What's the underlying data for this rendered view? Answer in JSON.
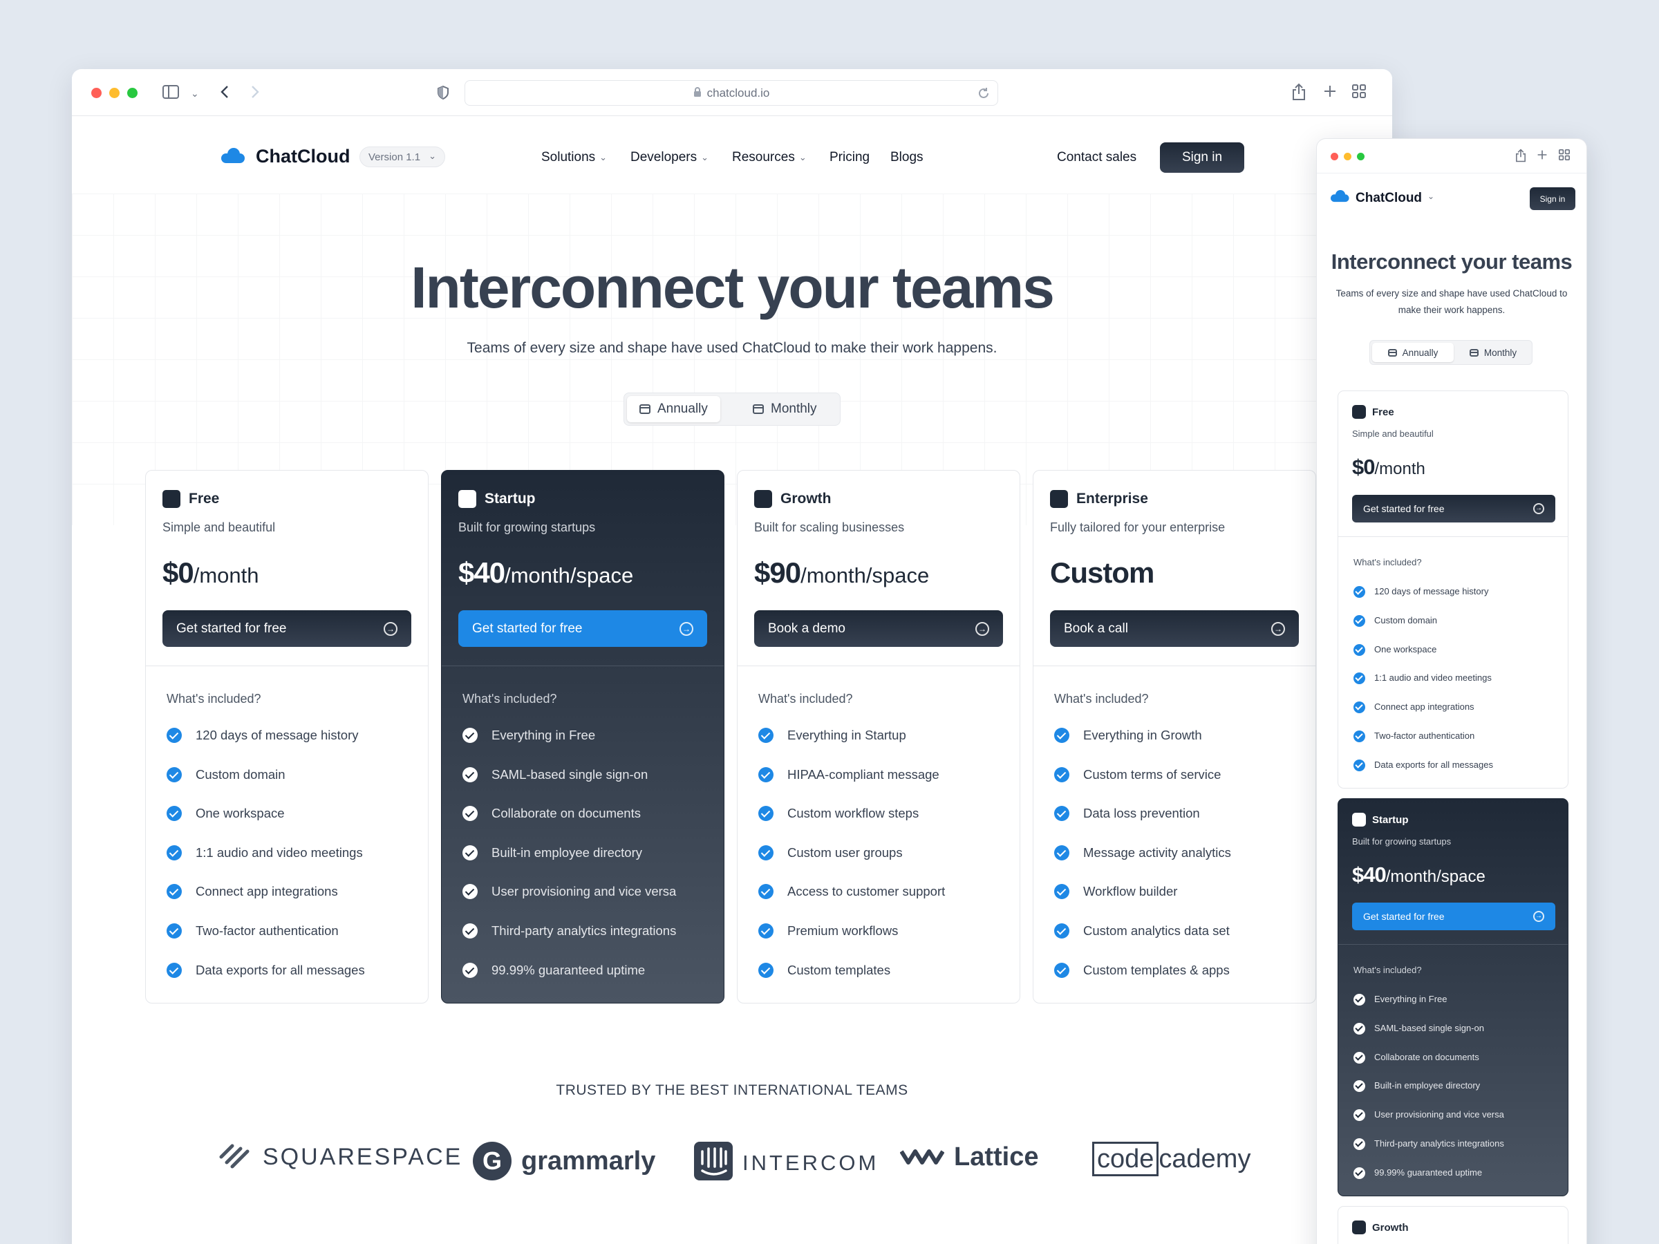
{
  "browser": {
    "url": "chatcloud.io"
  },
  "brand": {
    "name": "ChatCloud",
    "version": "Version 1.1"
  },
  "nav": {
    "items": [
      "Solutions",
      "Developers",
      "Resources",
      "Pricing",
      "Blogs"
    ],
    "contact": "Contact sales",
    "sign_in": "Sign in"
  },
  "hero": {
    "title": "Interconnect your teams",
    "subtitle": "Teams of every size and shape have used ChatCloud to make their work happens."
  },
  "billing": {
    "annually": "Annually",
    "monthly": "Monthly",
    "selected": "Annually"
  },
  "included_label": "What's included?",
  "plans": [
    {
      "name": "Free",
      "tagline": "Simple and beautiful",
      "price": "$0",
      "unit": "/month",
      "cta": "Get started for free",
      "features": [
        "120 days of message history",
        "Custom domain",
        "One workspace",
        "1:1 audio and video meetings",
        "Connect app integrations",
        "Two-factor authentication",
        "Data exports for all messages"
      ]
    },
    {
      "name": "Startup",
      "tagline": "Built for growing startups",
      "price": "$40",
      "unit": "/month/space",
      "cta": "Get started for free",
      "features": [
        "Everything in Free",
        "SAML-based single sign-on",
        "Collaborate on documents",
        "Built-in employee directory",
        "User provisioning and vice versa",
        "Third-party analytics integrations",
        "99.99% guaranteed uptime"
      ]
    },
    {
      "name": "Growth",
      "tagline": "Built for scaling businesses",
      "price": "$90",
      "unit": "/month/space",
      "cta": "Book a demo",
      "features": [
        "Everything in Startup",
        "HIPAA-compliant message",
        "Custom workflow steps",
        "Custom user groups",
        "Access to customer support",
        "Premium workflows",
        "Custom templates"
      ]
    },
    {
      "name": "Enterprise",
      "tagline": "Fully tailored for your enterprise",
      "price": "Custom",
      "unit": "",
      "cta": "Book a call",
      "features": [
        "Everything in Growth",
        "Custom terms of service",
        "Data loss prevention",
        "Message activity analytics",
        "Workflow builder",
        "Custom analytics data set",
        "Custom templates & apps"
      ]
    }
  ],
  "trusted": {
    "heading": "TRUSTED BY THE BEST INTERNATIONAL TEAMS",
    "logos": [
      "SQUARESPACE",
      "grammarly",
      "INTERCOM",
      "Lattice",
      "codecademy"
    ],
    "codecademy_parts": [
      "code",
      "cademy"
    ]
  },
  "colors": {
    "accent": "#1e88e5",
    "dark": "#1f2937",
    "page_bg": "#e2e8f0"
  },
  "icons": {
    "window_controls": [
      "sidebar-icon",
      "back-icon",
      "forward-icon",
      "shield-icon",
      "lock-icon",
      "reload-icon",
      "share-icon",
      "plus-icon",
      "tabs-icon"
    ],
    "features": "check-circle-icon",
    "cta": "arrow-circle-right-icon"
  }
}
